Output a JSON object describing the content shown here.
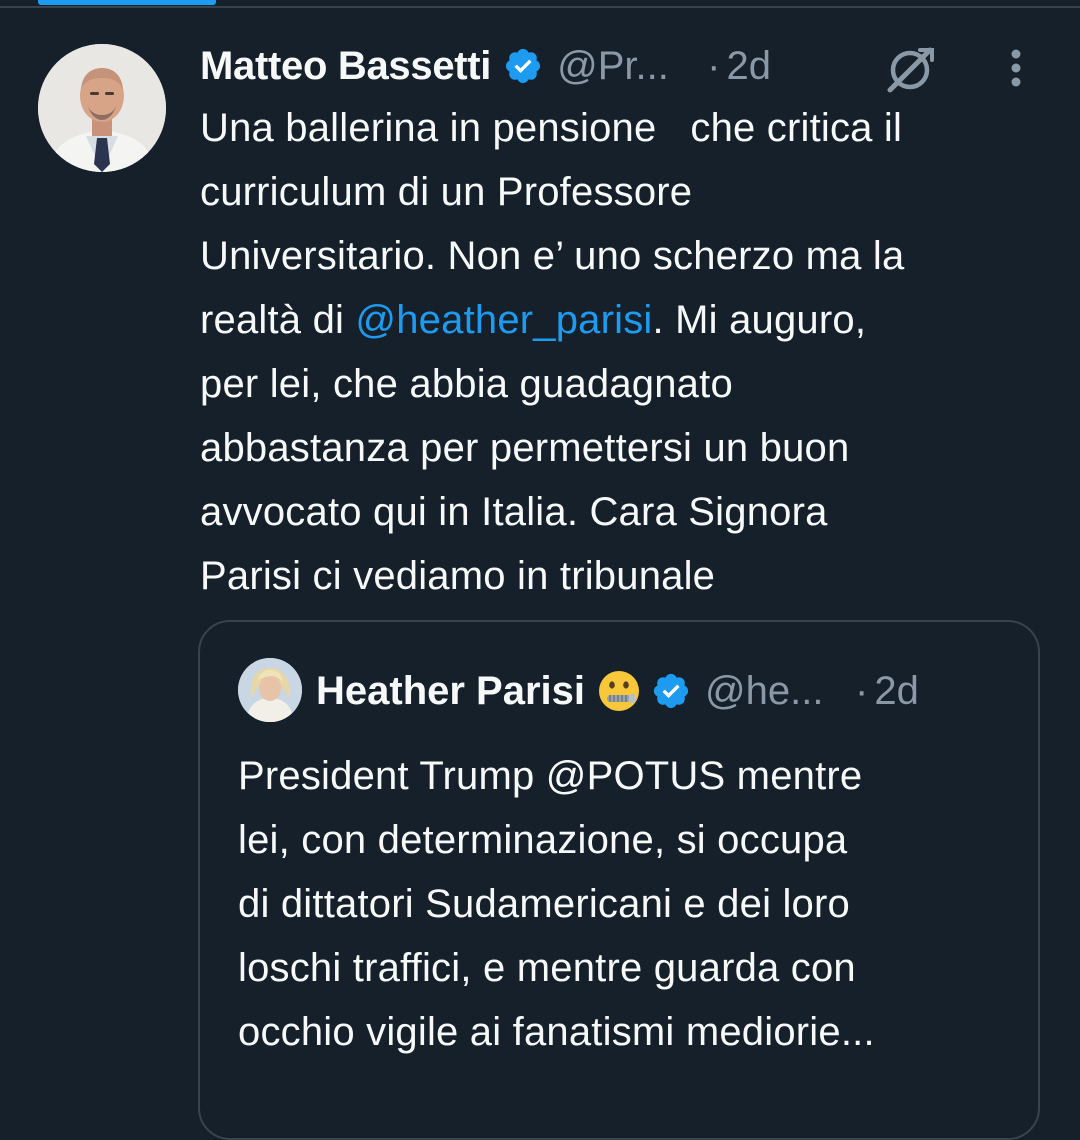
{
  "tweet": {
    "author_name": "Matteo Bassetti",
    "handle": "@Pr...",
    "separator": "·",
    "time": "2d",
    "text_lines": [
      [
        "Una ballerina in pensione   che critica il"
      ],
      [
        "curriculum di un Professore"
      ],
      [
        "Universitario. Non e’ uno scherzo ma la"
      ],
      [
        "realtà di ",
        "@heather_parisi",
        ". Mi auguro,"
      ],
      [
        "per lei, che abbia guadagnato"
      ],
      [
        "abbastanza per permettersi un buon"
      ],
      [
        "avvocato qui in Italia. Cara Signora"
      ],
      [
        "Parisi ci vediamo in tribunale"
      ]
    ],
    "icons": {
      "verified": "verified-badge-icon",
      "grok": "grok-icon",
      "more": "more-vertical-icon"
    }
  },
  "quoted_tweet": {
    "author_name": "Heather Parisi",
    "emoji": "zipper-mouth-face",
    "handle": "@he...",
    "separator": "·",
    "time": "2d",
    "text_lines": [
      "President Trump @POTUS mentre",
      "lei, con determinazione, si occupa",
      "di dittatori Sudamericani e dei loro",
      "loschi traffici, e mentre guarda con",
      "occhio vigile ai fanatismi mediorie..."
    ]
  },
  "colors": {
    "background": "#15202b",
    "text": "#f7f9f9",
    "secondary": "#8b98a5",
    "accent": "#1d9bf0",
    "border": "#38444d"
  }
}
